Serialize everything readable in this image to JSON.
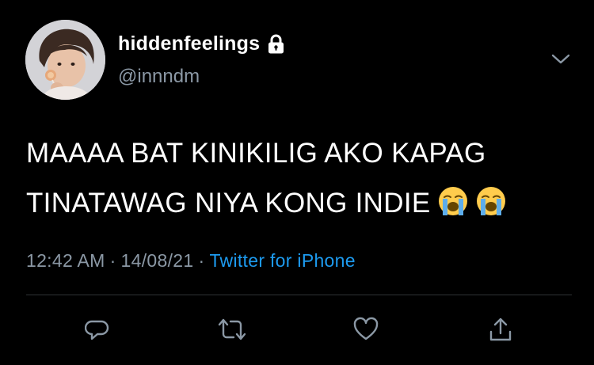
{
  "user": {
    "display_name": "hiddenfeelings",
    "handle": "@innndm",
    "protected_icon": "lock-icon",
    "avatar": "avatar"
  },
  "tweet": {
    "lines": [
      "MAAAA BAT KINIKILIG AKO KAPAG",
      "TINATAWAG NIYA KONG INDIE"
    ],
    "emojis": [
      "loudly-crying-face-emoji",
      "loudly-crying-face-emoji"
    ]
  },
  "meta": {
    "time": "12:42 AM",
    "separator": "·",
    "date": "14/08/21",
    "source": "Twitter for iPhone"
  },
  "actions": {
    "reply_icon": "reply-icon",
    "retweet_icon": "retweet-icon",
    "like_icon": "heart-icon",
    "share_icon": "share-icon"
  },
  "colors": {
    "background": "#000000",
    "text": "#ffffff",
    "secondary": "#8b98a5",
    "link": "#1d9bf0",
    "divider": "#2f3336"
  }
}
